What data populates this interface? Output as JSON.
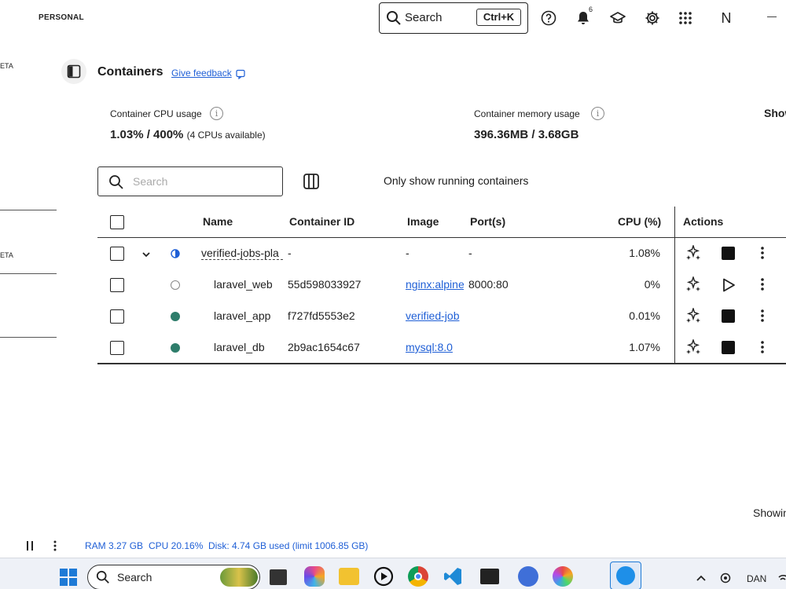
{
  "topbar": {
    "account_label": "PERSONAL",
    "search_label": "Search",
    "search_shortcut": "Ctrl+K",
    "notification_count": "6",
    "avatar_initial": "N",
    "icons": [
      "search-icon",
      "help-icon",
      "bell-icon",
      "learning-center-icon",
      "gear-icon",
      "apps-grid-icon"
    ]
  },
  "sidebar": {
    "beta_badge_1": "ETA",
    "beta_badge_2": "ETA"
  },
  "header": {
    "title": "Containers",
    "feedback_link": "Give feedback"
  },
  "stats": {
    "cpu_label": "Container CPU usage",
    "cpu_value": "1.03% / 400%",
    "cpu_sub": "(4 CPUs available)",
    "memory_label": "Container memory usage",
    "memory_value": "396.36MB / 3.68GB",
    "show_charts_partial": "Show"
  },
  "filters": {
    "search_placeholder": "Search",
    "only_running_label": "Only show running containers"
  },
  "table": {
    "columns": [
      "Name",
      "Container ID",
      "Image",
      "Port(s)",
      "CPU (%)",
      "Actions"
    ],
    "rows": [
      {
        "name": "verified-jobs-pla",
        "container_id": "-",
        "image": "-",
        "ports": "-",
        "cpu": "1.08%",
        "status": "partial",
        "expandable": true,
        "primary_action": "stop"
      },
      {
        "name": "laravel_web",
        "container_id": "55d598033927",
        "image": "nginx:alpine",
        "ports": "8000:80",
        "cpu": "0%",
        "status": "stopped",
        "expandable": false,
        "primary_action": "start"
      },
      {
        "name": "laravel_app",
        "container_id": "f727fd5553e2",
        "image": "verified-job",
        "ports": "",
        "cpu": "0.01%",
        "status": "running",
        "expandable": false,
        "primary_action": "stop"
      },
      {
        "name": "laravel_db",
        "container_id": "2b9ac1654c67",
        "image": "mysql:8.0",
        "ports": "",
        "cpu": "1.07%",
        "status": "running",
        "expandable": false,
        "primary_action": "stop"
      }
    ]
  },
  "footer": {
    "showing_partial": "Showin",
    "ram": "RAM 3.27 GB",
    "cpu": "CPU 20.16%",
    "disk": "Disk: 4.74 GB used (limit 1006.85 GB)"
  },
  "taskbar": {
    "search_label": "Search",
    "language": "DAN",
    "apps": [
      "windows-start-icon",
      "file-manager-icon",
      "copilot-icon",
      "folder-icon",
      "media-player-icon",
      "chrome-icon",
      "vscode-icon",
      "terminal-icon",
      "app-icon",
      "color-app-icon",
      "docker-icon"
    ]
  },
  "colors": {
    "link_blue": "#1f5fd6",
    "running_green": "#2e7d6b",
    "partial_blue": "#1f5fd6"
  }
}
